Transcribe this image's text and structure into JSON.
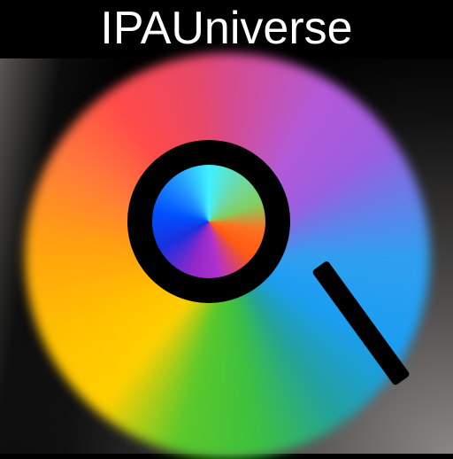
{
  "header": {
    "title": "IPAUniverse"
  },
  "icon": {
    "name": "magnifier-icon",
    "colors": {
      "red": "#ff4a4a",
      "purple": "#b45ad8",
      "blue": "#1a9ef2",
      "green": "#3cc040",
      "yellow": "#ffd000",
      "orange": "#ffa010"
    }
  }
}
